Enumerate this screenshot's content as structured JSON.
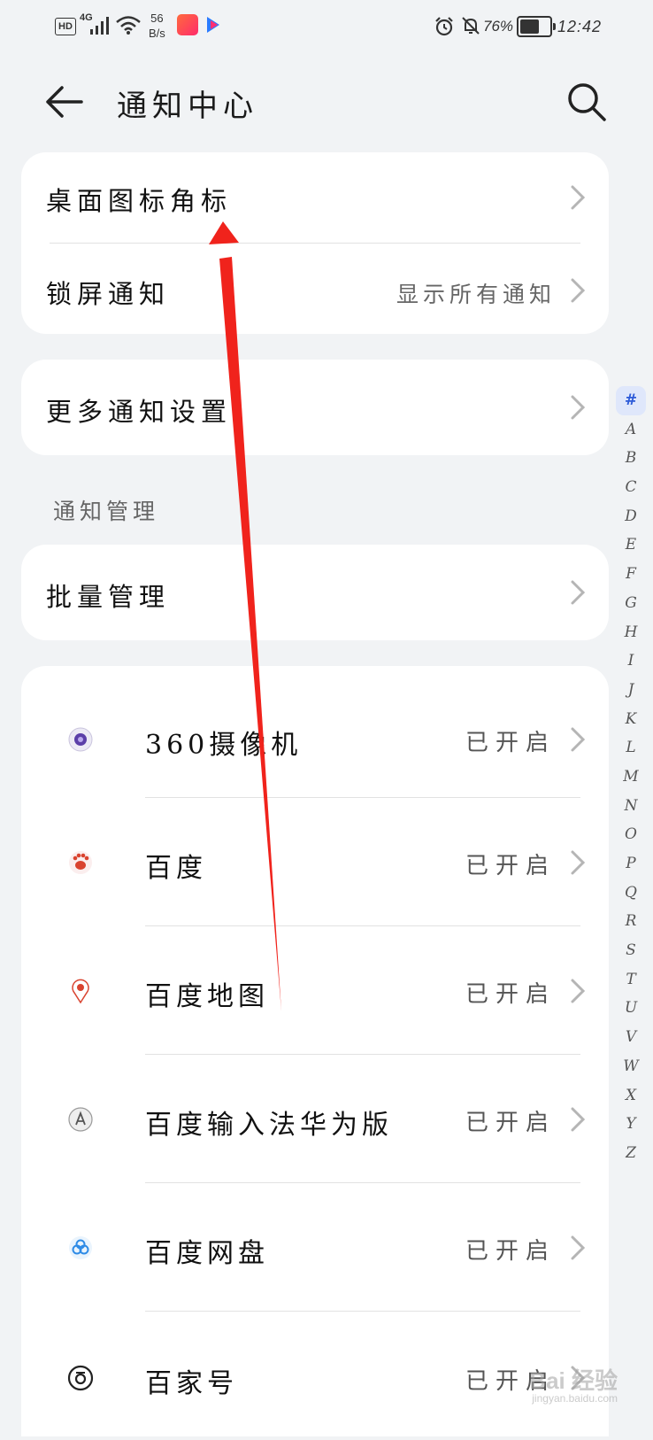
{
  "status_bar": {
    "hd": "HD",
    "network": "4G",
    "speed_top": "56",
    "speed_bottom": "B/s",
    "battery_pct": "76%",
    "battery_level": 0.76,
    "time": "12:42"
  },
  "header": {
    "title": "通知中心",
    "back_icon": "back-arrow-icon",
    "search_icon": "search-icon"
  },
  "general": {
    "badge": "桌面图标角标",
    "lockscreen": "锁屏通知",
    "lockscreen_value": "显示所有通知"
  },
  "more": {
    "label": "更多通知设置"
  },
  "management": {
    "section_title": "通知管理",
    "batch": "批量管理"
  },
  "apps": [
    {
      "name": "360摄像机",
      "status": "已开启",
      "icon": "camera-360-icon",
      "color": "#5b3fa8"
    },
    {
      "name": "百度",
      "status": "已开启",
      "icon": "baidu-paw-icon",
      "color": "#d9432f"
    },
    {
      "name": "百度地图",
      "status": "已开启",
      "icon": "baidu-map-pin-icon",
      "color": "#d9432f"
    },
    {
      "name": "百度输入法华为版",
      "status": "已开启",
      "icon": "baidu-input-icon",
      "color": "#555555"
    },
    {
      "name": "百度网盘",
      "status": "已开启",
      "icon": "baidu-netdisk-icon",
      "color": "#2e8be6"
    },
    {
      "name": "百家号",
      "status": "已开启",
      "icon": "baijiahao-icon",
      "color": "#222222"
    }
  ],
  "index_letters": [
    "#",
    "A",
    "B",
    "C",
    "D",
    "E",
    "F",
    "G",
    "H",
    "I",
    "J",
    "K",
    "L",
    "M",
    "N",
    "O",
    "P",
    "Q",
    "R",
    "S",
    "T",
    "U",
    "V",
    "W",
    "X",
    "Y",
    "Z"
  ],
  "watermark": {
    "text": "Bai 经验",
    "sub": "jingyan.baidu.com"
  },
  "accent": "#2d5bd8",
  "annotation_color": "#f0231c"
}
